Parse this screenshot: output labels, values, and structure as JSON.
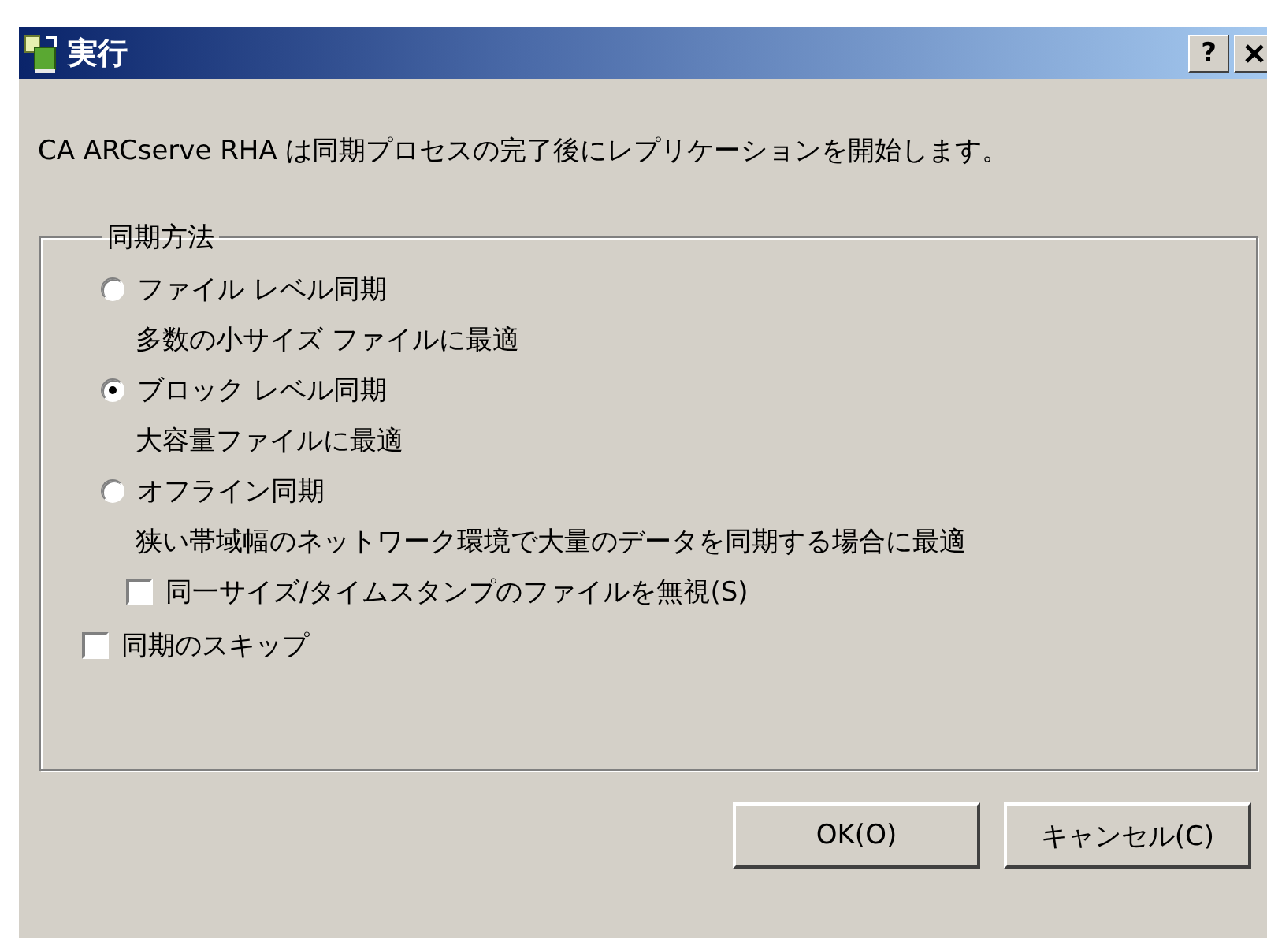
{
  "window": {
    "title": "実行",
    "help": "?"
  },
  "message": "CA ARCserve RHA は同期プロセスの完了後にレプリケーションを開始します。",
  "group": {
    "title": "同期方法",
    "options": [
      {
        "kind": "radio",
        "label": "ファイル レベル同期",
        "description": "多数の小サイズ ファイルに最適",
        "selected": false
      },
      {
        "kind": "radio",
        "label": "ブロック レベル同期",
        "description": "大容量ファイルに最適",
        "selected": true
      },
      {
        "kind": "radio",
        "label": "オフライン同期",
        "description": "狭い帯域幅のネットワーク環境で大量のデータを同期する場合に最適",
        "selected": false,
        "sub": {
          "label": "同一サイズ/タイムスタンプのファイルを無視(S)",
          "checked": false
        }
      },
      {
        "kind": "checkbox",
        "label": "同期のスキップ",
        "checked": false
      }
    ]
  },
  "buttons": [
    "OK(O)",
    "キャンセル(C)"
  ]
}
